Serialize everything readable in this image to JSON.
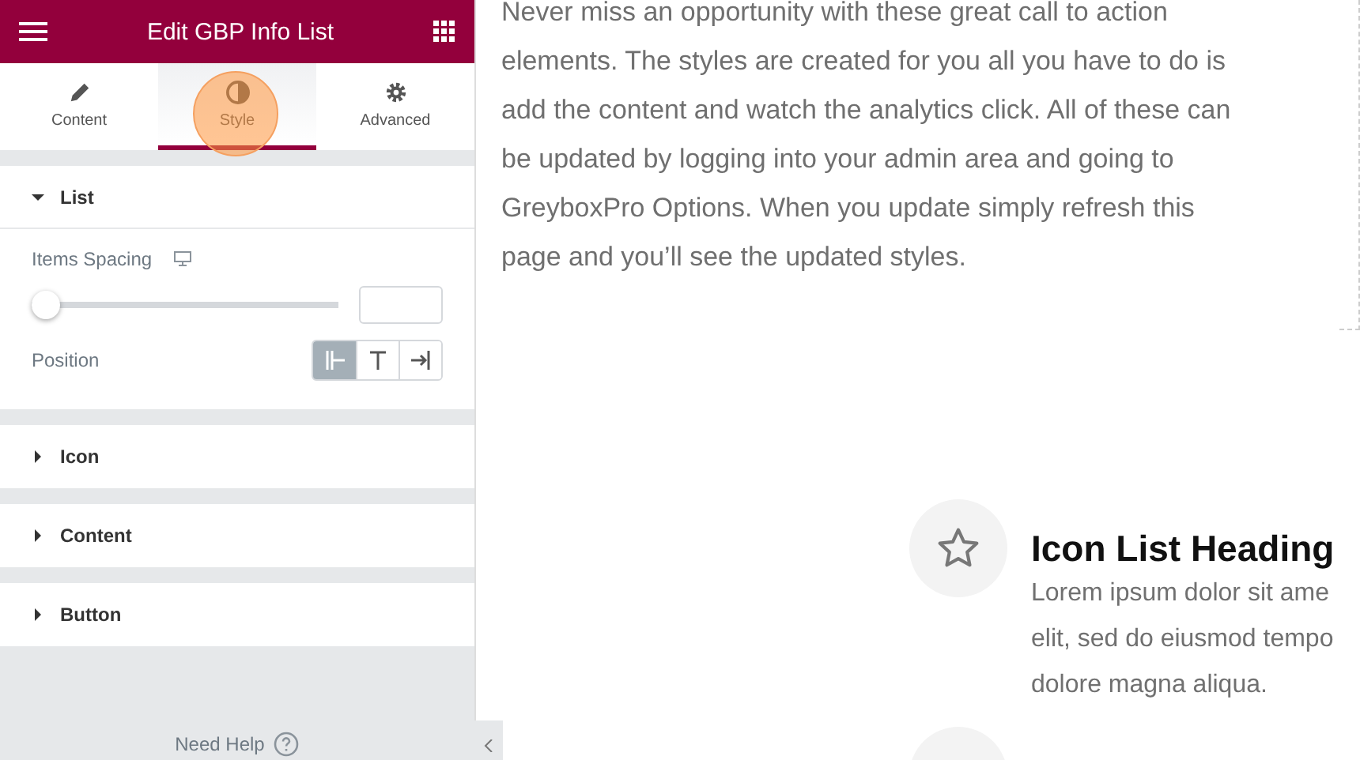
{
  "panel": {
    "title": "Edit GBP Info List",
    "tabs": [
      {
        "label": "Content",
        "selected": false
      },
      {
        "label": "Style",
        "selected": true
      },
      {
        "label": "Advanced",
        "selected": false
      }
    ],
    "sections": [
      {
        "title": "List",
        "expanded": true,
        "controls": [
          {
            "kind": "slider",
            "label": "Items Spacing",
            "level": 0
          },
          {
            "kind": "choice",
            "label": "Position",
            "options": [
              {
                "selected": true
              },
              {
                "selected": false
              },
              {
                "selected": false
              }
            ]
          }
        ]
      },
      {
        "title": "Icon",
        "expanded": false
      },
      {
        "title": "Content",
        "expanded": false
      },
      {
        "title": "Button",
        "expanded": false
      }
    ],
    "help": "Need Help"
  },
  "page": {
    "paragraph": "Never miss an opportunity with these great call to action elements. The styles are created for you all you have to do is add the content and watch the analytics click.  All of these can be updated by logging into your admin area and going to GreyboxPro Options. When you update simply refresh this page and you’ll see the updated styles.",
    "list_item": {
      "heading": "Icon List Heading",
      "lines": [
        "Lorem ipsum dolor sit ame",
        "elit, sed do eiusmod tempo",
        "dolore magna aliqua."
      ]
    }
  }
}
